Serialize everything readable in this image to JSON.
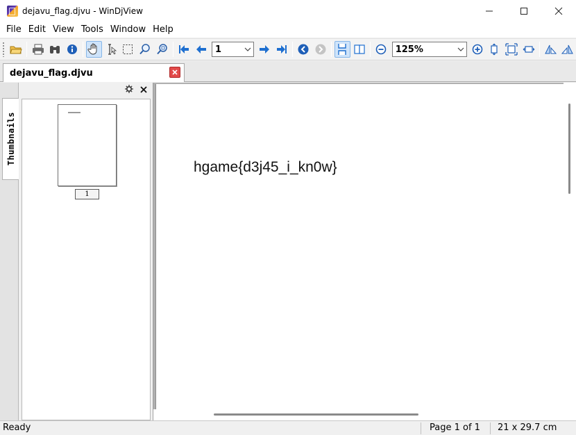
{
  "window": {
    "title": "dejavu_flag.djvu - WinDjView",
    "controls": [
      "minimize-icon",
      "maximize-icon",
      "close-icon"
    ]
  },
  "menu": {
    "items": [
      "File",
      "Edit",
      "View",
      "Tools",
      "Window",
      "Help"
    ]
  },
  "toolbar": {
    "page_value": "1",
    "zoom_value": "125%",
    "active_tools": [
      "hand-tool",
      "continuous-layout"
    ]
  },
  "tab": {
    "label": "dejavu_flag.djvu"
  },
  "sidebar": {
    "tab_label": "Thumbnails",
    "thumb_page_number": "1"
  },
  "document": {
    "text": "hgame{d3j45_i_kn0w}"
  },
  "status": {
    "left": "Ready",
    "page": "Page 1 of 1",
    "size": "21 x 29.7 cm"
  },
  "colors": {
    "accent_blue": "#1e6fd0",
    "close_tab_red": "#e24a4a"
  }
}
